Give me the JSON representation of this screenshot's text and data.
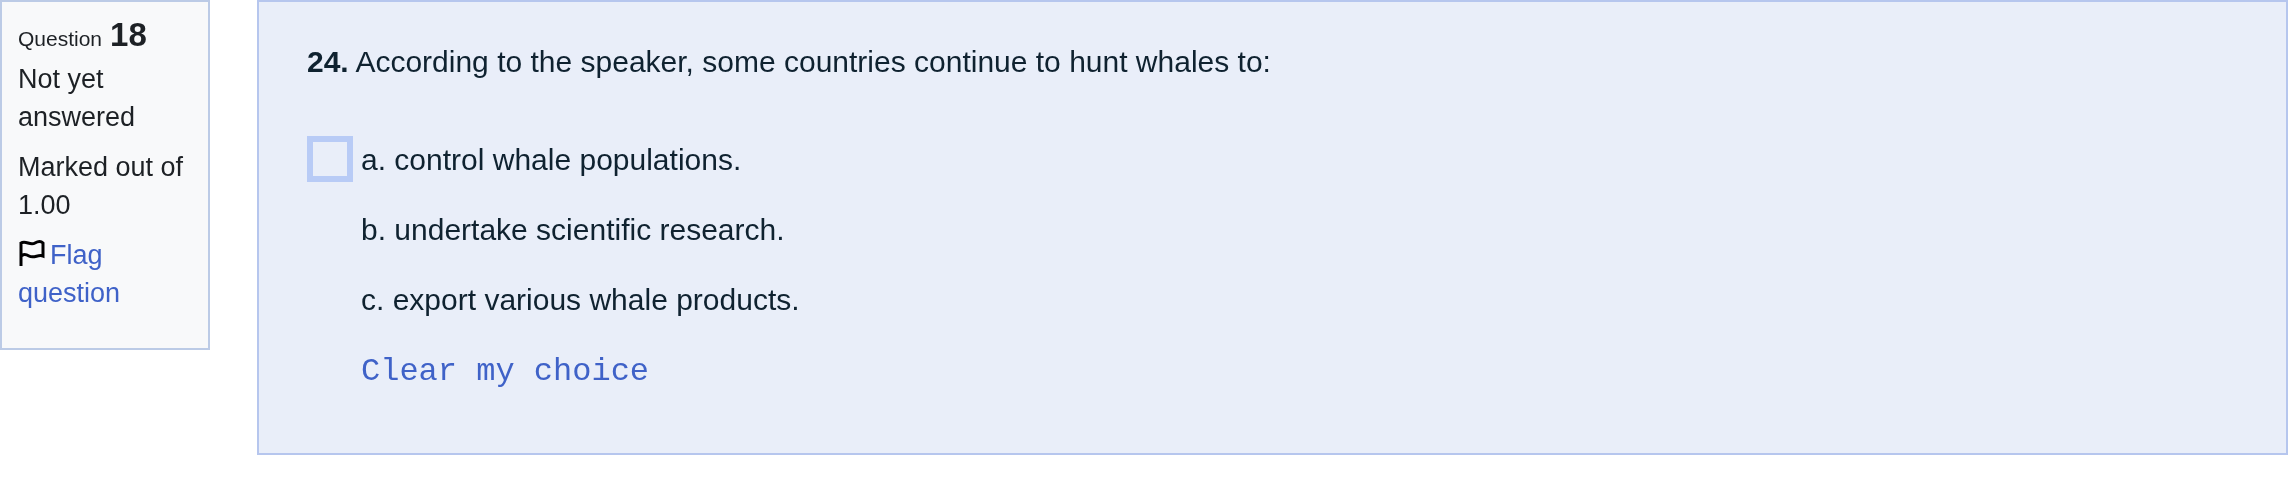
{
  "info": {
    "label": "Question",
    "number": "18",
    "state": "Not yet answered",
    "marks": "Marked out of 1.00",
    "flag_link": "Flag question"
  },
  "question": {
    "number": "24.",
    "text": "According to the speaker, some countries continue to hunt whales to:",
    "options": [
      {
        "label": "a. control whale populations.",
        "focused": true
      },
      {
        "label": "b. undertake scientific research.",
        "focused": false
      },
      {
        "label": "c. export various whale products.",
        "focused": false
      }
    ],
    "clear_link": "Clear my choice"
  }
}
